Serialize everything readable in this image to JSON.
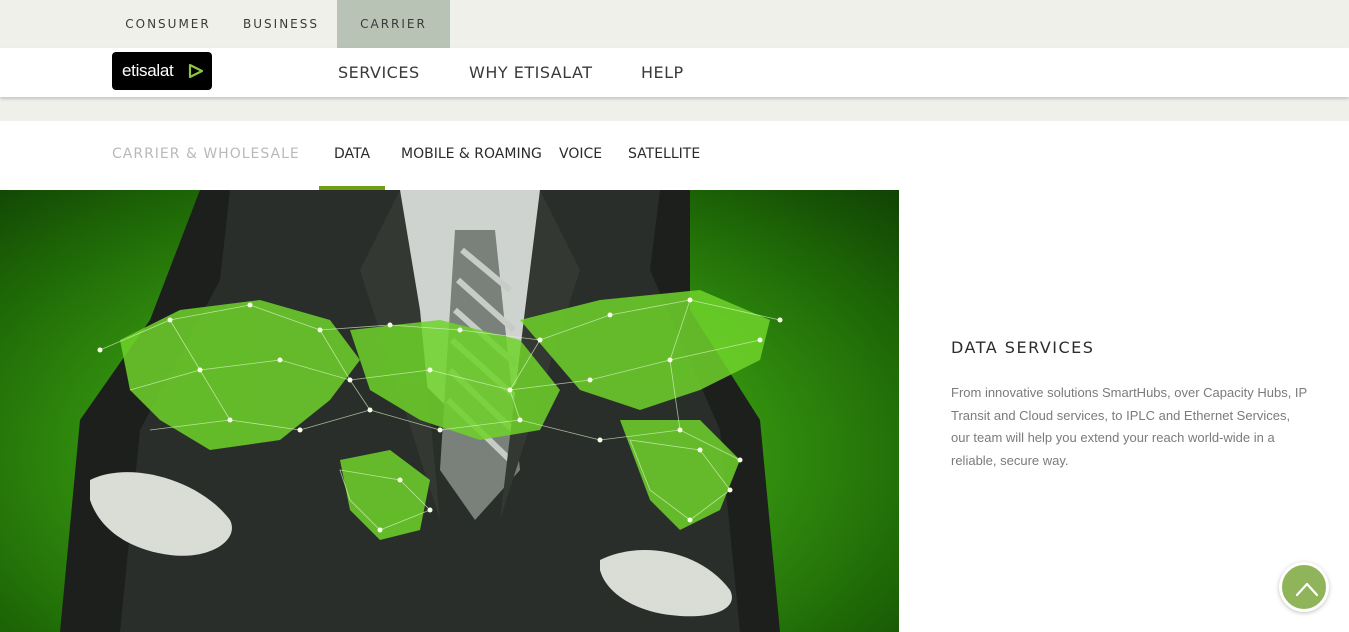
{
  "segments": {
    "consumer": "CONSUMER",
    "business": "BUSINESS",
    "carrier": "CARRIER",
    "active": "carrier"
  },
  "brand": {
    "logo_text": "etisalat",
    "accent": "#719e19",
    "logo_green": "#8cc63f"
  },
  "main_nav": {
    "services": "SERVICES",
    "why": "WHY ETISALAT",
    "help": "HELP"
  },
  "sub_nav": {
    "section": "CARRIER & WHOLESALE",
    "items": [
      "DATA",
      "MOBILE & ROAMING",
      "VOICE",
      "SATELLITE"
    ],
    "active": "DATA"
  },
  "content": {
    "title": "DATA SERVICES",
    "description": "From innovative solutions SmartHubs, over Capacity Hubs, IP Transit and Cloud services, to IPLC and Ethernet Services, our team will help you extend your reach world-wide in a reliable, secure way."
  },
  "scroll_button_icon": "chevron-up-icon"
}
